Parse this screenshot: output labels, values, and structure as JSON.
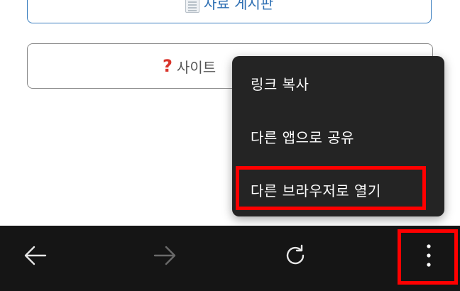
{
  "page": {
    "board_button_label": "자료 게시판",
    "about_button_label": "사이트",
    "board_icon": "document-icon",
    "about_icon": "question-mark-icon"
  },
  "menu": {
    "items": [
      {
        "label": "링크 복사"
      },
      {
        "label": "다른 앱으로 공유"
      },
      {
        "label": "다른 브라우저로 열기"
      }
    ]
  },
  "toolbar": {
    "buttons": [
      "back-arrow-icon",
      "forward-arrow-icon",
      "reload-icon",
      "more-vertical-icon"
    ]
  },
  "colors": {
    "menu_background": "#242424",
    "toolbar_background": "#151515",
    "highlight": "#ff0000",
    "link_blue": "#2e6fb3"
  }
}
